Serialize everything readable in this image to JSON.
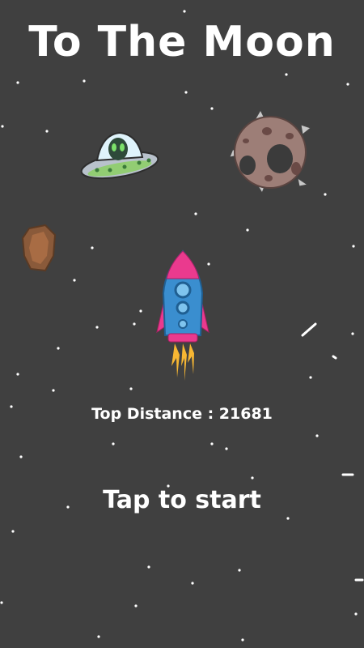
{
  "game": {
    "title": "To The Moon",
    "top_distance_label": "Top Distance : 21681",
    "tap_to_start": "Tap to start"
  },
  "colors": {
    "background": "#404040",
    "rocket_body": "#3a8ecf",
    "rocket_accent": "#ea3a8e",
    "flame": "#f7b733",
    "ufo_hull": "#b9c2cc",
    "alien": "#2e4a3a",
    "asteroid_large": "#9d7e77",
    "asteroid_small": "#8a5a3a"
  },
  "icons": [
    "ufo-alien-icon",
    "spiky-asteroid-icon",
    "brown-asteroid-icon",
    "rocket-icon"
  ]
}
